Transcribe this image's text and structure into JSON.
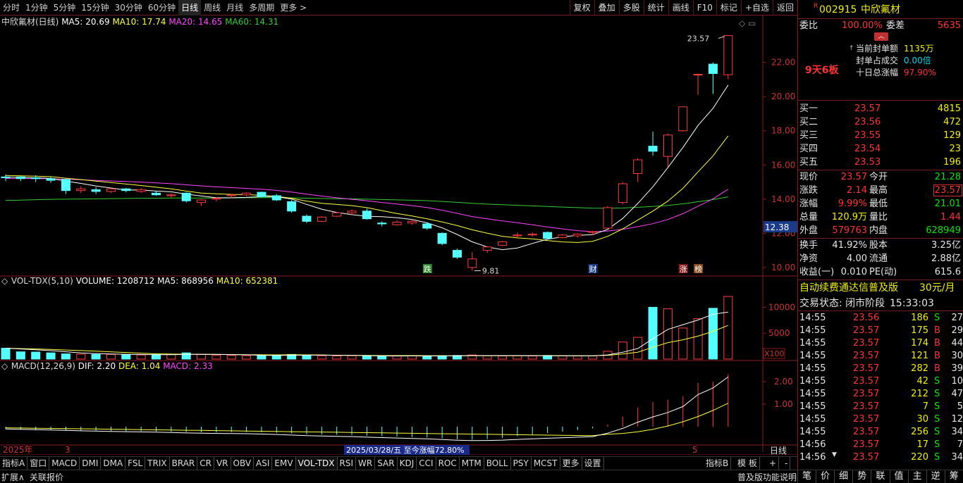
{
  "periods": [
    "分时",
    "1分钟",
    "5分钟",
    "15分钟",
    "30分钟",
    "60分钟",
    "日线",
    "周线",
    "月线",
    "多周期",
    "更多 >"
  ],
  "active_period": "日线",
  "toolbar": [
    "复权",
    "叠加",
    "多股",
    "统计",
    "画线",
    "F10",
    "标记",
    "+自选",
    "返回"
  ],
  "chart": {
    "ma_line": {
      "title": "中欣氟材(日线)",
      "ma5": "MA5: 20.69",
      "ma10": "MA10: 17.74",
      "ma20": "MA20: 14.65",
      "ma60": "MA60: 14.31"
    },
    "vol_line": {
      "title": "VOL-TDX(5,10)",
      "volume": "VOLUME: 1208712",
      "ma5": "MA5: 868956",
      "ma10": "MA10: 652381"
    },
    "macd_line": {
      "title": "MACD(12,26,9)",
      "dif": "DIF: 2.20",
      "dea": "DEA: 1.04",
      "macd": "MACD: 2.33"
    },
    "price_axis": [
      "22.00",
      "20.00",
      "18.00",
      "16.00",
      "14.00",
      "12.00",
      "10.00"
    ],
    "current_price_tag": "12.38",
    "vol_axis": [
      "10000",
      "5000"
    ],
    "vol_unit": "X100",
    "macd_axis": [
      "2.00",
      "1.00"
    ],
    "max_label": "23.57",
    "min_label": "9.81",
    "tags": [
      "跌",
      "财",
      "涨",
      "榜"
    ],
    "date_labels": [
      "2025年",
      "3",
      "5"
    ],
    "cursor_info": "2025/03/28/五  至今涨幅72.80%",
    "daily_label": "日线",
    "colors": {
      "up": "#ff3c3c",
      "down": "#54ffff",
      "ma5": "#ffffff",
      "ma10": "#ffff3c",
      "ma20": "#ff44ff",
      "ma60": "#32cd32"
    }
  },
  "chart_data": {
    "type": "candlestick",
    "note": "daily K-line, ~50 sessions",
    "ohlc": [
      [
        15.3,
        15.45,
        15.05,
        15.25
      ],
      [
        15.3,
        15.35,
        15.05,
        15.2
      ],
      [
        15.25,
        15.4,
        15.0,
        15.2
      ],
      [
        15.2,
        15.3,
        14.95,
        15.1
      ],
      [
        15.15,
        15.2,
        14.3,
        14.5
      ],
      [
        14.5,
        14.75,
        14.35,
        14.6
      ],
      [
        14.55,
        14.7,
        14.3,
        14.45
      ],
      [
        14.45,
        14.65,
        14.35,
        14.6
      ],
      [
        14.6,
        14.65,
        14.4,
        14.5
      ],
      [
        14.45,
        14.65,
        14.35,
        14.55
      ],
      [
        14.35,
        14.5,
        14.2,
        14.25
      ],
      [
        14.2,
        14.35,
        14.1,
        14.25
      ],
      [
        14.35,
        14.4,
        13.8,
        13.9
      ],
      [
        13.8,
        14.0,
        13.6,
        13.95
      ],
      [
        14.0,
        14.1,
        13.85,
        14.05
      ],
      [
        14.2,
        14.3,
        14.05,
        14.25
      ],
      [
        14.25,
        14.4,
        14.15,
        14.35
      ],
      [
        14.4,
        14.45,
        14.1,
        14.15
      ],
      [
        14.2,
        14.3,
        13.9,
        13.95
      ],
      [
        13.85,
        13.95,
        13.2,
        13.3
      ],
      [
        13.0,
        13.1,
        12.6,
        12.7
      ],
      [
        12.7,
        13.0,
        12.65,
        12.95
      ],
      [
        13.0,
        13.25,
        12.95,
        13.2
      ],
      [
        13.2,
        13.4,
        13.05,
        13.3
      ],
      [
        13.3,
        13.45,
        12.8,
        12.85
      ],
      [
        12.6,
        12.7,
        12.4,
        12.55
      ],
      [
        12.5,
        12.75,
        12.45,
        12.65
      ],
      [
        12.6,
        12.8,
        12.5,
        12.7
      ],
      [
        12.55,
        12.65,
        12.2,
        12.3
      ],
      [
        12.0,
        12.05,
        11.3,
        11.4
      ],
      [
        11.0,
        11.1,
        10.5,
        10.6
      ],
      [
        10.0,
        10.9,
        9.81,
        10.5
      ],
      [
        11.0,
        11.25,
        10.85,
        11.2
      ],
      [
        11.3,
        11.55,
        11.25,
        11.5
      ],
      [
        11.85,
        12.05,
        11.7,
        11.9
      ],
      [
        11.9,
        12.05,
        11.8,
        11.95
      ],
      [
        12.05,
        12.1,
        11.65,
        11.7
      ],
      [
        11.75,
        11.95,
        11.7,
        11.9
      ],
      [
        11.85,
        12.0,
        11.75,
        11.95
      ],
      [
        12.05,
        12.15,
        11.9,
        12.1
      ],
      [
        12.3,
        13.6,
        12.25,
        13.5
      ],
      [
        13.8,
        15.0,
        13.7,
        14.9
      ],
      [
        15.5,
        16.4,
        15.0,
        16.3
      ],
      [
        17.1,
        17.95,
        16.55,
        16.8
      ],
      [
        16.5,
        17.85,
        15.9,
        17.75
      ],
      [
        18.0,
        19.4,
        17.95,
        19.4
      ],
      [
        21.3,
        21.35,
        20.1,
        21.3
      ],
      [
        21.9,
        22.0,
        20.15,
        21.35
      ],
      [
        21.28,
        23.57,
        21.01,
        23.57
      ]
    ],
    "volume": [
      2100,
      1400,
      1350,
      1200,
      1000,
      950,
      900,
      900,
      850,
      800,
      850,
      880,
      1200,
      900,
      700,
      700,
      650,
      700,
      750,
      900,
      800,
      650,
      600,
      650,
      600,
      550,
      600,
      650,
      600,
      650,
      700,
      800,
      650,
      600,
      650,
      600,
      700,
      620,
      600,
      600,
      1500,
      3300,
      4200,
      10000,
      9700,
      6000,
      7800,
      9800,
      12087
    ],
    "price_axis_range": [
      9.5,
      24.5
    ],
    "macd_bars": [
      -0.1,
      -0.12,
      -0.13,
      -0.14,
      -0.16,
      -0.18,
      -0.18,
      -0.19,
      -0.2,
      -0.2,
      -0.21,
      -0.22,
      -0.24,
      -0.25,
      -0.25,
      -0.24,
      -0.24,
      -0.25,
      -0.27,
      -0.3,
      -0.34,
      -0.35,
      -0.36,
      -0.37,
      -0.4,
      -0.42,
      -0.44,
      -0.46,
      -0.48,
      -0.52,
      -0.56,
      -0.58,
      -0.55,
      -0.5,
      -0.42,
      -0.35,
      -0.28,
      -0.22,
      -0.15,
      -0.08,
      0.1,
      0.45,
      0.85,
      1.1,
      1.2,
      1.35,
      1.95,
      2.0,
      2.33
    ]
  }
}
